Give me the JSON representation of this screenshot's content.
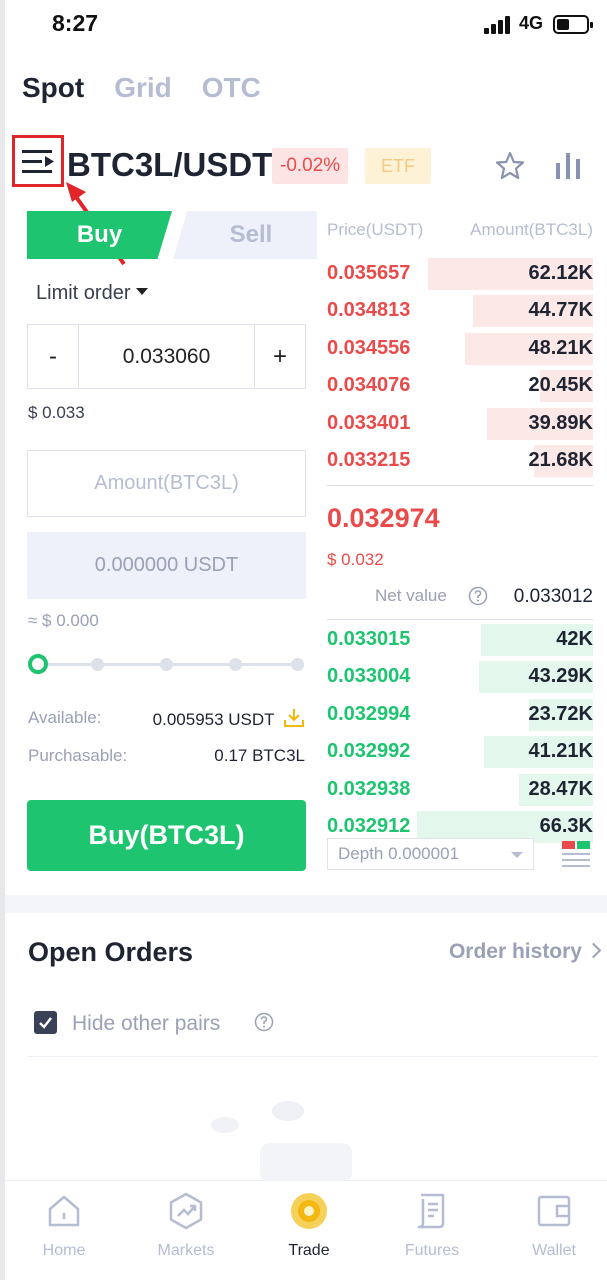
{
  "status_bar": {
    "time": "8:27",
    "network": "4G"
  },
  "top_tabs": [
    {
      "label": "Spot",
      "active": true
    },
    {
      "label": "Grid",
      "active": false
    },
    {
      "label": "OTC",
      "active": false
    }
  ],
  "pair": {
    "symbol": "BTC3L/USDT",
    "change": "-0.02%",
    "badge": "ETF"
  },
  "trade_form": {
    "buy_tab": "Buy",
    "sell_tab": "Sell",
    "order_type": "Limit order",
    "price_value": "0.033060",
    "minus": "-",
    "plus": "+",
    "price_usd": "$ 0.033",
    "amount_placeholder": "Amount(BTC3L)",
    "total_value": "0.000000 USDT",
    "approx_value": "≈ $ 0.000",
    "slider_percent": 0,
    "available_label": "Available:",
    "available_value": "0.005953 USDT",
    "purchasable_label": "Purchasable:",
    "purchasable_value": "0.17 BTC3L",
    "buy_button": "Buy(BTC3L)"
  },
  "order_book": {
    "price_header": "Price(USDT)",
    "amount_header": "Amount(BTC3L)",
    "asks": [
      {
        "price": "0.035657",
        "amount": "62.12K",
        "depth": 0.62
      },
      {
        "price": "0.034813",
        "amount": "44.77K",
        "depth": 0.45
      },
      {
        "price": "0.034556",
        "amount": "48.21K",
        "depth": 0.48
      },
      {
        "price": "0.034076",
        "amount": "20.45K",
        "depth": 0.2
      },
      {
        "price": "0.033401",
        "amount": "39.89K",
        "depth": 0.4
      },
      {
        "price": "0.033215",
        "amount": "21.68K",
        "depth": 0.22
      }
    ],
    "last_price": "0.032974",
    "last_price_usd": "$ 0.032",
    "net_value_label": "Net value",
    "net_value": "0.033012",
    "bids": [
      {
        "price": "0.033015",
        "amount": "42K",
        "depth": 0.42
      },
      {
        "price": "0.033004",
        "amount": "43.29K",
        "depth": 0.43
      },
      {
        "price": "0.032994",
        "amount": "23.72K",
        "depth": 0.24
      },
      {
        "price": "0.032992",
        "amount": "41.21K",
        "depth": 0.41
      },
      {
        "price": "0.032938",
        "amount": "28.47K",
        "depth": 0.28
      },
      {
        "price": "0.032912",
        "amount": "66.3K",
        "depth": 0.66
      }
    ],
    "depth_select": "Depth 0.000001"
  },
  "open_orders": {
    "title": "Open Orders",
    "history_link": "Order history",
    "hide_other_pairs": "Hide other pairs",
    "hide_checked": true
  },
  "bottom_nav": [
    {
      "label": "Home",
      "icon": "home-icon",
      "active": false
    },
    {
      "label": "Markets",
      "icon": "markets-icon",
      "active": false
    },
    {
      "label": "Trade",
      "icon": "trade-icon",
      "active": true
    },
    {
      "label": "Futures",
      "icon": "futures-icon",
      "active": false
    },
    {
      "label": "Wallet",
      "icon": "wallet-icon",
      "active": false
    }
  ],
  "colors": {
    "buy_green": "#1ec46f",
    "sell_red": "#e94b4b",
    "muted": "#b6bdd3",
    "highlight_red": "#e0262a"
  }
}
